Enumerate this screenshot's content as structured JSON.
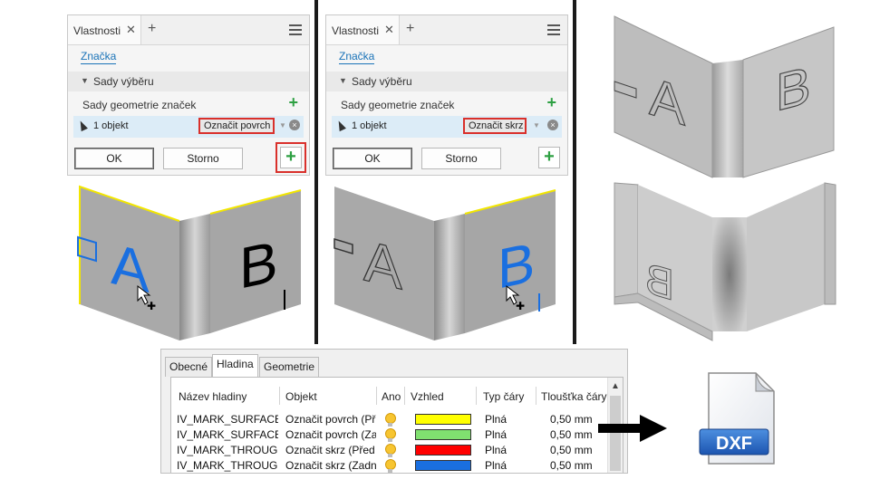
{
  "panels": [
    {
      "tab_label": "Vlastnosti",
      "tab_close": "✕",
      "tab_add": "+",
      "link": "Značka",
      "section_title": "Sady výběru",
      "section_arrow": "▼",
      "sets_label": "Sady geometrie značek",
      "sets_add": "+",
      "object_count": "1 objekt",
      "dropdown_value": "Označit povrch",
      "clear": "×",
      "ok_label": "OK",
      "cancel_label": "Storno",
      "add_label": "+"
    },
    {
      "tab_label": "Vlastnosti",
      "tab_close": "✕",
      "tab_add": "+",
      "link": "Značka",
      "section_title": "Sady výběru",
      "section_arrow": "▼",
      "sets_label": "Sady geometrie značek",
      "sets_add": "+",
      "object_count": "1 objekt",
      "dropdown_value": "Označit skrz",
      "clear": "×",
      "ok_label": "OK",
      "cancel_label": "Storno",
      "add_label": "+"
    }
  ],
  "models": {
    "letter_a": "A",
    "letter_b": "B"
  },
  "dialog": {
    "tabs": [
      "Obecné",
      "Hladina",
      "Geometrie"
    ],
    "columns": [
      "Název hladiny",
      "Objekt",
      "Ano",
      "Vzhled",
      "Typ čáry",
      "Tloušťka čáry"
    ],
    "scroll_up": "▲",
    "rows": [
      {
        "name": "IV_MARK_SURFACE",
        "object": "Označit povrch (Př",
        "color": "#ffff00",
        "linetype": "Plná",
        "thickness": "0,50 mm"
      },
      {
        "name": "IV_MARK_SURFACE_",
        "object": "Označit povrch (Za",
        "color": "#80e070",
        "linetype": "Plná",
        "thickness": "0,50 mm"
      },
      {
        "name": "IV_MARK_THROUGH",
        "object": "Označit skrz (Před",
        "color": "#ff0000",
        "linetype": "Plná",
        "thickness": "0,50 mm"
      },
      {
        "name": "IV_MARK_THROUGH_",
        "object": "Označit skrz (Zadn",
        "color": "#1a6fe0",
        "linetype": "Plná",
        "thickness": "0,50 mm"
      }
    ]
  },
  "file_icon": {
    "label": "DXF"
  }
}
